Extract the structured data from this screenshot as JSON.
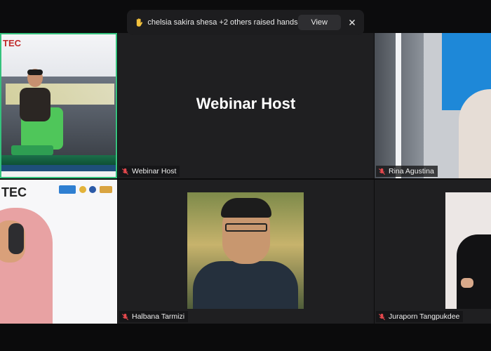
{
  "notification": {
    "message": "chelsia sakira shesa +2 others raised hands",
    "view_label": "View",
    "icon": "raised-hand-icon",
    "close_icon": "close-icon"
  },
  "tiles": [
    {
      "name": "stage-speaker",
      "label": "",
      "muted": false,
      "active_speaker": true,
      "logo_text": "TEC"
    },
    {
      "name": "webinar-host",
      "label": "Webinar Host",
      "center_name": "Webinar Host",
      "muted": true
    },
    {
      "name": "rina-agustina",
      "label": "Rina Agustina",
      "muted": true
    },
    {
      "name": "presenter",
      "label": "",
      "muted": false,
      "logo_text": "TEC"
    },
    {
      "name": "halbana-tarmizi",
      "label": "Halbana Tarmizi",
      "muted": true
    },
    {
      "name": "juraporn-tangpukdee",
      "label": "Juraporn Tangpukdee",
      "muted": true
    }
  ],
  "colors": {
    "background": "#0c0c0d",
    "tile": "#1f1f21",
    "active_speaker_border": "#35c27d",
    "muted_icon": "#e5484d"
  }
}
